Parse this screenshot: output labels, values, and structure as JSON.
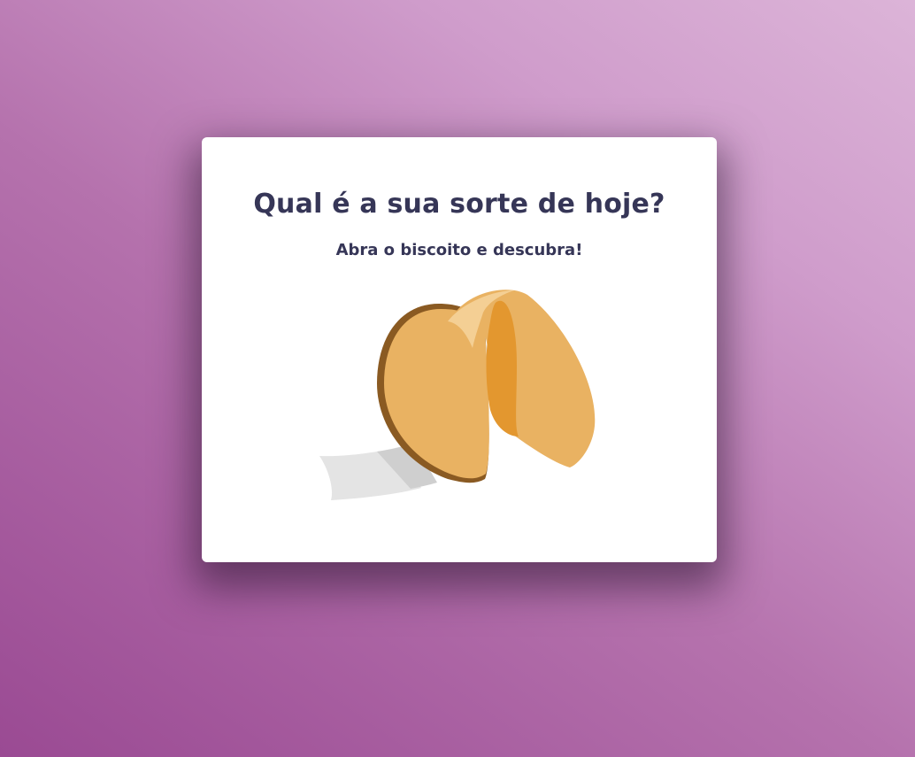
{
  "page": {
    "title": "Qual é a sua sorte de hoje?",
    "subtitle": "Abra o biscoito e descubra!"
  },
  "cookie": {
    "icon": "fortune-cookie-icon",
    "colors": {
      "dough": "#e9b262",
      "dough_dark": "#e3972f",
      "shadow": "#8a5a22",
      "highlight": "#f4cf94",
      "paper": "#e4e4e4",
      "paper_shade": "#cfcfcf"
    }
  },
  "colors": {
    "text": "#363657",
    "card": "#ffffff",
    "background_start": "#9a4a93",
    "background_end": "#dcb4d8"
  }
}
